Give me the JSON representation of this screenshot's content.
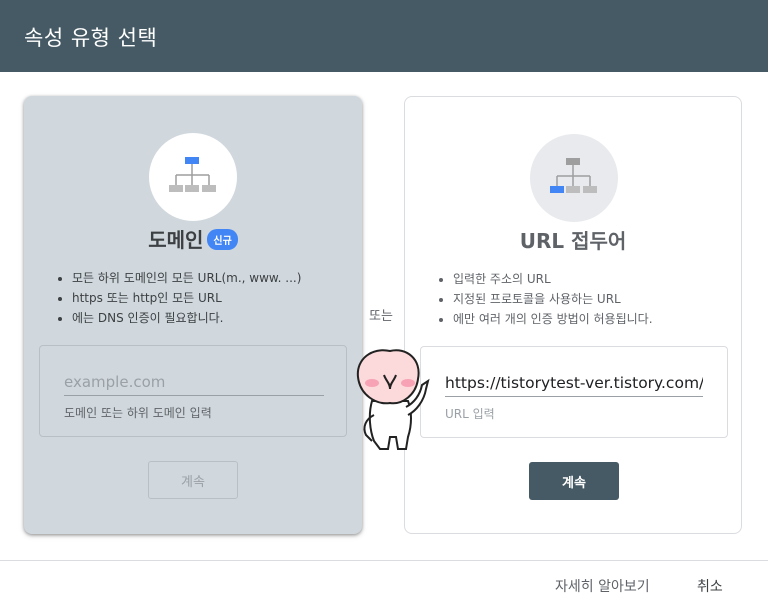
{
  "dialog": {
    "title": "속성 유형 선택"
  },
  "domain_card": {
    "title": "도메인",
    "badge": "신규",
    "bullets": [
      "모든 하위 도메인의 모든 URL(m., www. ...)",
      "https 또는 http인 모든 URL",
      "에는 DNS 인증이 필요합니다."
    ],
    "input": {
      "placeholder": "example.com",
      "hint": "도메인 또는 하위 도메인 입력"
    },
    "continue_label": "계속",
    "icon": "sitemap-icon",
    "accent_color": "#4285f4"
  },
  "separator": {
    "text": "또는"
  },
  "url_card": {
    "title": "URL 접두어",
    "bullets": [
      "입력한 주소의 URL",
      "지정된 프로토콜을 사용하는 URL",
      "에만 여러 개의 인증 방법이 허용됩니다."
    ],
    "input": {
      "value": "https://tistorytest-ver.tistory.com/",
      "hint": "URL 입력"
    },
    "continue_label": "계속",
    "icon": "sitemap-icon"
  },
  "footer": {
    "learn_more": "자세히 알아보기",
    "cancel": "취소"
  },
  "colors": {
    "header_bg": "#455a64",
    "primary_button": "#455a64",
    "badge": "#4285f4"
  }
}
